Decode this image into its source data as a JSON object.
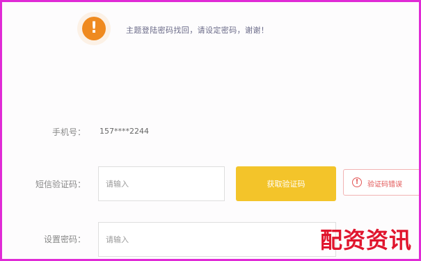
{
  "notice": {
    "icon": "exclamation-icon",
    "text": "主题登陆密码找回，请设定密码，谢谢！"
  },
  "form": {
    "phone": {
      "label": "手机号：",
      "value": "157****2244"
    },
    "sms_code": {
      "label": "短信验证码：",
      "placeholder": "请输入",
      "send_button": "获取验证码",
      "error": "验证码错误"
    },
    "password": {
      "label": "设置密码：",
      "placeholder": "请输入"
    }
  },
  "watermark": "配资资讯",
  "colors": {
    "accent": "#f3c42a",
    "warning": "#ef8a20",
    "error": "#e25555",
    "border": "#e02ad6"
  }
}
